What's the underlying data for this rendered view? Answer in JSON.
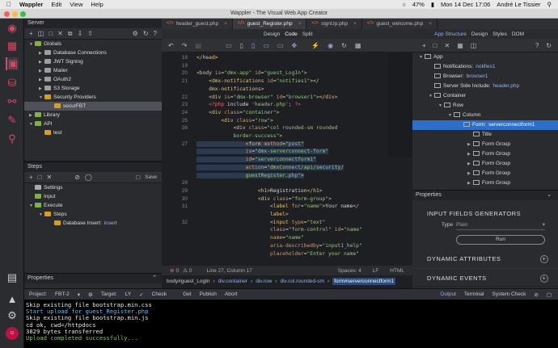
{
  "menubar": {
    "apple": "",
    "app": "Wappler",
    "items": [
      "Edit",
      "View",
      "Help"
    ],
    "battery": "47%",
    "clock": "Mon 14 Dec 17:06",
    "user": "André Le Tissier"
  },
  "window": {
    "title": "Wappler - The Visual Web App Creator"
  },
  "server": {
    "header": "Server",
    "tree": [
      {
        "label": "Globals",
        "level": 0,
        "icon": "folder-icon",
        "expanded": true
      },
      {
        "label": "Database Connections",
        "level": 1,
        "icon": "database-icon",
        "expanded": false
      },
      {
        "label": "JWT Signing",
        "level": 1,
        "icon": "key-icon",
        "expanded": false
      },
      {
        "label": "Mailer",
        "level": 1,
        "icon": "mail-icon",
        "expanded": false
      },
      {
        "label": "OAuth2",
        "level": 1,
        "icon": "oauth-icon",
        "expanded": false
      },
      {
        "label": "S3 Storage",
        "level": 1,
        "icon": "cloud-icon",
        "expanded": false
      },
      {
        "label": "Security Providers",
        "level": 1,
        "icon": "shield-icon",
        "expanded": true
      },
      {
        "label": "securFBT",
        "level": 2,
        "icon": "provider-icon",
        "selected": true
      },
      {
        "label": "Library",
        "level": 0,
        "icon": "folder-icon",
        "expanded": false
      },
      {
        "label": "API",
        "level": 0,
        "icon": "folder-icon",
        "expanded": true
      },
      {
        "label": "test",
        "level": 1,
        "icon": "file-icon"
      }
    ]
  },
  "steps": {
    "header": "Steps",
    "save_label": "Save",
    "tree": [
      {
        "label": "Settings",
        "level": 0,
        "icon": "gear-icon"
      },
      {
        "label": "Input",
        "level": 0,
        "icon": "input-icon"
      },
      {
        "label": "Execute",
        "level": 0,
        "icon": "execute-icon",
        "expanded": true
      },
      {
        "label": "Steps",
        "level": 1,
        "icon": "steps-icon",
        "expanded": true
      },
      {
        "label": "Database Insert:",
        "value": "insert",
        "level": 2,
        "icon": "db-insert-icon"
      }
    ]
  },
  "leftprops": {
    "header": "Properties"
  },
  "tabs": [
    {
      "label": "header_guest.php",
      "active": false
    },
    {
      "label": "guest_Register.php",
      "active": true
    },
    {
      "label": "signUp.php",
      "active": false
    },
    {
      "label": "guest_welcome.php",
      "active": false
    }
  ],
  "modes": {
    "design": "Design",
    "code": "Code",
    "split": "Split",
    "app_structure": "App Structure",
    "design2": "Design",
    "styles": "Styles",
    "dom": "DOM"
  },
  "code": {
    "lines": [
      {
        "n": "18",
        "html": "<span class='tg'>&lt;/head&gt;</span>"
      },
      {
        "n": "19",
        "html": ""
      },
      {
        "n": "20",
        "html": "<span class='tg'>&lt;body</span> <span class='at'>is</span>=<span class='st'>\"dmx-app\"</span> <span class='at'>id</span>=<span class='st'>\"guest_LogIn\"</span><span class='tg'>&gt;</span>"
      },
      {
        "n": "21",
        "html": "&nbsp;&nbsp;&nbsp;&nbsp;<span class='tg'>&lt;dmx-notifications</span> <span class='at'>id</span>=<span class='st'>\"notifies1\"</span><span class='tg'>&gt;&lt;/</span>"
      },
      {
        "n": "",
        "html": "&nbsp;&nbsp;&nbsp;&nbsp;<span class='tg'>dmx-notifications&gt;</span>"
      },
      {
        "n": "22",
        "html": "&nbsp;&nbsp;&nbsp;&nbsp;<span class='tg'>&lt;div</span> <span class='at'>is</span>=<span class='st'>\"dmx-browser\"</span> <span class='at'>id</span>=<span class='st'>\"browser1\"</span><span class='tg'>&gt;&lt;/div&gt;</span>"
      },
      {
        "n": "23",
        "html": "&nbsp;&nbsp;&nbsp;&nbsp;<span class='kw'>&lt;?php</span> include <span class='st'>'header.php'</span>; <span class='kw'>?&gt;</span>"
      },
      {
        "n": "24",
        "html": "&nbsp;&nbsp;&nbsp;&nbsp;<span class='tg'>&lt;div</span> <span class='at'>class</span>=<span class='st'>\"container\"</span><span class='tg'>&gt;</span>"
      },
      {
        "n": "25",
        "html": "&nbsp;&nbsp;&nbsp;&nbsp;&nbsp;&nbsp;&nbsp;&nbsp;<span class='tg'>&lt;div</span> <span class='at'>class</span>=<span class='st'>\"row\"</span><span class='tg'>&gt;</span>"
      },
      {
        "n": "26",
        "html": "&nbsp;&nbsp;&nbsp;&nbsp;&nbsp;&nbsp;&nbsp;&nbsp;&nbsp;&nbsp;&nbsp;&nbsp;<span class='tg'>&lt;div</span> <span class='at'>class</span>=<span class='st'>\"col rounded-sm rounded</span>"
      },
      {
        "n": "",
        "html": "&nbsp;&nbsp;&nbsp;&nbsp;&nbsp;&nbsp;&nbsp;&nbsp;&nbsp;&nbsp;&nbsp;&nbsp;<span class='st'>border-success\"</span><span class='tg'>&gt;</span>"
      },
      {
        "n": "27",
        "html": "&nbsp;&nbsp;&nbsp;&nbsp;&nbsp;&nbsp;&nbsp;&nbsp;&nbsp;&nbsp;&nbsp;&nbsp;&nbsp;&nbsp;&nbsp;&nbsp;<span class='tg'>&lt;form</span> <span class='at'>method</span>=<span class='st'>\"post\"</span>"
      },
      {
        "n": "",
        "html": "&nbsp;&nbsp;&nbsp;&nbsp;&nbsp;&nbsp;&nbsp;&nbsp;&nbsp;&nbsp;&nbsp;&nbsp;&nbsp;&nbsp;&nbsp;&nbsp;<span class='at'>is</span>=<span class='st'>\"dmx-serverconnect-form\"</span>"
      },
      {
        "n": "",
        "html": "&nbsp;&nbsp;&nbsp;&nbsp;&nbsp;&nbsp;&nbsp;&nbsp;&nbsp;&nbsp;&nbsp;&nbsp;&nbsp;&nbsp;&nbsp;&nbsp;<span class='at'>id</span>=<span class='st'>\"serverconnectform1\"</span>"
      },
      {
        "n": "",
        "html": "&nbsp;&nbsp;&nbsp;&nbsp;&nbsp;&nbsp;&nbsp;&nbsp;&nbsp;&nbsp;&nbsp;&nbsp;&nbsp;&nbsp;&nbsp;&nbsp;<span class='at'>action</span>=<span class='st'>\"dmxConnect/api/security/</span>"
      },
      {
        "n": "",
        "html": "&nbsp;&nbsp;&nbsp;&nbsp;&nbsp;&nbsp;&nbsp;&nbsp;&nbsp;&nbsp;&nbsp;&nbsp;&nbsp;&nbsp;&nbsp;&nbsp;<span class='st'>guestRegister.php\"</span><span class='tg'>&gt;</span>"
      },
      {
        "n": "28",
        "html": ""
      },
      {
        "n": "29",
        "html": "&nbsp;&nbsp;&nbsp;&nbsp;&nbsp;&nbsp;&nbsp;&nbsp;&nbsp;&nbsp;&nbsp;&nbsp;&nbsp;&nbsp;&nbsp;&nbsp;&nbsp;&nbsp;&nbsp;&nbsp;<span class='tg'>&lt;h1&gt;</span>Registration<span class='tg'>&lt;/h1&gt;</span>"
      },
      {
        "n": "30",
        "html": "&nbsp;&nbsp;&nbsp;&nbsp;&nbsp;&nbsp;&nbsp;&nbsp;&nbsp;&nbsp;&nbsp;&nbsp;&nbsp;&nbsp;&nbsp;&nbsp;&nbsp;&nbsp;&nbsp;&nbsp;<span class='tg'>&lt;div</span> <span class='at'>class</span>=<span class='st'>\"form-group\"</span><span class='tg'>&gt;</span>"
      },
      {
        "n": "31",
        "html": "&nbsp;&nbsp;&nbsp;&nbsp;&nbsp;&nbsp;&nbsp;&nbsp;&nbsp;&nbsp;&nbsp;&nbsp;&nbsp;&nbsp;&nbsp;&nbsp;&nbsp;&nbsp;&nbsp;&nbsp;&nbsp;&nbsp;&nbsp;&nbsp;<span class='tg'>&lt;label</span> <span class='at'>for</span>=<span class='st'>\"name\"</span><span class='tg'>&gt;</span>Your name<span class='tg'>&lt;/</span>"
      },
      {
        "n": "",
        "html": "&nbsp;&nbsp;&nbsp;&nbsp;&nbsp;&nbsp;&nbsp;&nbsp;&nbsp;&nbsp;&nbsp;&nbsp;&nbsp;&nbsp;&nbsp;&nbsp;&nbsp;&nbsp;&nbsp;&nbsp;&nbsp;&nbsp;&nbsp;&nbsp;<span class='tg'>label&gt;</span>"
      },
      {
        "n": "32",
        "html": "&nbsp;&nbsp;&nbsp;&nbsp;&nbsp;&nbsp;&nbsp;&nbsp;&nbsp;&nbsp;&nbsp;&nbsp;&nbsp;&nbsp;&nbsp;&nbsp;&nbsp;&nbsp;&nbsp;&nbsp;&nbsp;&nbsp;&nbsp;&nbsp;<span class='tg'>&lt;input</span> <span class='at'>type</span>=<span class='st'>\"text\"</span>"
      },
      {
        "n": "",
        "html": "&nbsp;&nbsp;&nbsp;&nbsp;&nbsp;&nbsp;&nbsp;&nbsp;&nbsp;&nbsp;&nbsp;&nbsp;&nbsp;&nbsp;&nbsp;&nbsp;&nbsp;&nbsp;&nbsp;&nbsp;&nbsp;&nbsp;&nbsp;&nbsp;<span class='at'>class</span>=<span class='st'>\"form-control\"</span> <span class='at'>id</span>=<span class='st'>\"name\"</span>"
      },
      {
        "n": "",
        "html": "&nbsp;&nbsp;&nbsp;&nbsp;&nbsp;&nbsp;&nbsp;&nbsp;&nbsp;&nbsp;&nbsp;&nbsp;&nbsp;&nbsp;&nbsp;&nbsp;&nbsp;&nbsp;&nbsp;&nbsp;&nbsp;&nbsp;&nbsp;&nbsp;<span class='at'>name</span>=<span class='st'>\"name\"</span>"
      },
      {
        "n": "",
        "html": "&nbsp;&nbsp;&nbsp;&nbsp;&nbsp;&nbsp;&nbsp;&nbsp;&nbsp;&nbsp;&nbsp;&nbsp;&nbsp;&nbsp;&nbsp;&nbsp;&nbsp;&nbsp;&nbsp;&nbsp;&nbsp;&nbsp;&nbsp;&nbsp;<span class='at'>aria-describedby</span>=<span class='st'>\"input1_help\"</span>"
      },
      {
        "n": "",
        "html": "&nbsp;&nbsp;&nbsp;&nbsp;&nbsp;&nbsp;&nbsp;&nbsp;&nbsp;&nbsp;&nbsp;&nbsp;&nbsp;&nbsp;&nbsp;&nbsp;&nbsp;&nbsp;&nbsp;&nbsp;&nbsp;&nbsp;&nbsp;&nbsp;<span class='at'>placeholder</span>=<span class='st'>\"Enter your name\"</span>"
      }
    ]
  },
  "editor_status": {
    "errors": "0",
    "warnings": "0",
    "position": "Line 27, Column 17",
    "spaces": "Spaces: 4",
    "eol": "LF",
    "lang": "HTML"
  },
  "breadcrumb": [
    "body#guest_LogIn",
    "div.container",
    "div.row",
    "div.col.rounded-sm",
    "form#serverconnectform1"
  ],
  "structure": {
    "tree": [
      {
        "label": "App",
        "level": 0,
        "expanded": true
      },
      {
        "label": "Notifications:",
        "value": "notifies1",
        "level": 1
      },
      {
        "label": "Browser:",
        "value": "browser1",
        "level": 1
      },
      {
        "label": "Server Side Include:",
        "value": "header.php",
        "level": 1
      },
      {
        "label": "Container",
        "level": 1,
        "expanded": true
      },
      {
        "label": "Row",
        "level": 2,
        "expanded": true
      },
      {
        "label": "Column",
        "level": 3,
        "expanded": true
      },
      {
        "label": "Form:",
        "value": "serverconnectform1",
        "level": 4,
        "selected": true
      },
      {
        "label": "Title",
        "level": 5
      },
      {
        "label": "Form Group",
        "level": 5
      },
      {
        "label": "Form Group",
        "level": 5
      },
      {
        "label": "Form Group",
        "level": 5
      },
      {
        "label": "Form Group",
        "level": 5
      },
      {
        "label": "Form Group",
        "level": 5
      }
    ]
  },
  "rightprops": {
    "header": "Properties",
    "generators": "INPUT FIELDS GENERATORS",
    "type_label": "Type",
    "type_value": "Plain",
    "run_label": "Run",
    "sections": [
      "DYNAMIC ATTRIBUTES",
      "DYNAMIC EVENTS"
    ]
  },
  "bottombar": {
    "project_label": "Project:",
    "project": "FBT-2",
    "target_label": "Target:",
    "target": "LY",
    "check": "Check",
    "get": "Get",
    "publish": "Publish",
    "abort": "Abort",
    "output": "Output",
    "terminal": "Terminal",
    "system_check": "System Check"
  },
  "terminal": {
    "lines": [
      {
        "text": "Skip existing file bootstrap.min.css",
        "cls": ""
      },
      {
        "text": "Start upload for guest_Register.php",
        "cls": "info"
      },
      {
        "text": "Skip existing file bootstrap.min.js",
        "cls": ""
      },
      {
        "text": "cd ok, cwd=/httpdocs",
        "cls": ""
      },
      {
        "text": "3829 bytes transferred",
        "cls": ""
      },
      {
        "text": "Upload completed successfully...",
        "cls": "ok"
      }
    ]
  },
  "colors": {
    "accent": "#d24b63",
    "selection": "#2d6ec9",
    "tab_active": "#3a3b40"
  }
}
